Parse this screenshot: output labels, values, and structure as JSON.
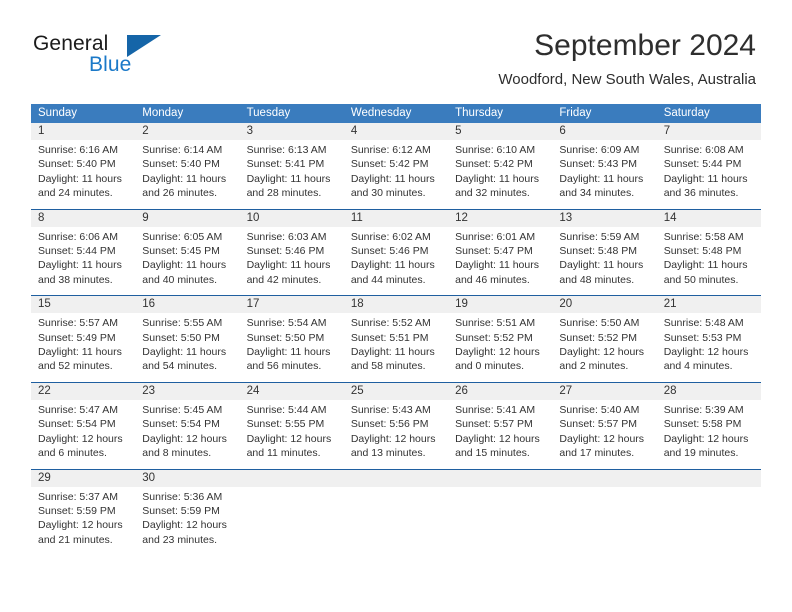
{
  "brand": {
    "name_part1": "General",
    "name_part2": "Blue",
    "logo_icon": "triangle-flag-icon"
  },
  "header": {
    "title": "September 2024",
    "location": "Woodford, New South Wales, Australia"
  },
  "weekdays": [
    "Sunday",
    "Monday",
    "Tuesday",
    "Wednesday",
    "Thursday",
    "Friday",
    "Saturday"
  ],
  "colors": {
    "header_band": "#3a7cbe",
    "row_divider": "#1f5fa0",
    "day_band": "#f0f0f0",
    "brand_blue": "#1b79c8",
    "text": "#333333"
  },
  "weeks": [
    [
      {
        "day": "1",
        "sunrise": "Sunrise: 6:16 AM",
        "sunset": "Sunset: 5:40 PM",
        "daylight": "Daylight: 11 hours and 24 minutes."
      },
      {
        "day": "2",
        "sunrise": "Sunrise: 6:14 AM",
        "sunset": "Sunset: 5:40 PM",
        "daylight": "Daylight: 11 hours and 26 minutes."
      },
      {
        "day": "3",
        "sunrise": "Sunrise: 6:13 AM",
        "sunset": "Sunset: 5:41 PM",
        "daylight": "Daylight: 11 hours and 28 minutes."
      },
      {
        "day": "4",
        "sunrise": "Sunrise: 6:12 AM",
        "sunset": "Sunset: 5:42 PM",
        "daylight": "Daylight: 11 hours and 30 minutes."
      },
      {
        "day": "5",
        "sunrise": "Sunrise: 6:10 AM",
        "sunset": "Sunset: 5:42 PM",
        "daylight": "Daylight: 11 hours and 32 minutes."
      },
      {
        "day": "6",
        "sunrise": "Sunrise: 6:09 AM",
        "sunset": "Sunset: 5:43 PM",
        "daylight": "Daylight: 11 hours and 34 minutes."
      },
      {
        "day": "7",
        "sunrise": "Sunrise: 6:08 AM",
        "sunset": "Sunset: 5:44 PM",
        "daylight": "Daylight: 11 hours and 36 minutes."
      }
    ],
    [
      {
        "day": "8",
        "sunrise": "Sunrise: 6:06 AM",
        "sunset": "Sunset: 5:44 PM",
        "daylight": "Daylight: 11 hours and 38 minutes."
      },
      {
        "day": "9",
        "sunrise": "Sunrise: 6:05 AM",
        "sunset": "Sunset: 5:45 PM",
        "daylight": "Daylight: 11 hours and 40 minutes."
      },
      {
        "day": "10",
        "sunrise": "Sunrise: 6:03 AM",
        "sunset": "Sunset: 5:46 PM",
        "daylight": "Daylight: 11 hours and 42 minutes."
      },
      {
        "day": "11",
        "sunrise": "Sunrise: 6:02 AM",
        "sunset": "Sunset: 5:46 PM",
        "daylight": "Daylight: 11 hours and 44 minutes."
      },
      {
        "day": "12",
        "sunrise": "Sunrise: 6:01 AM",
        "sunset": "Sunset: 5:47 PM",
        "daylight": "Daylight: 11 hours and 46 minutes."
      },
      {
        "day": "13",
        "sunrise": "Sunrise: 5:59 AM",
        "sunset": "Sunset: 5:48 PM",
        "daylight": "Daylight: 11 hours and 48 minutes."
      },
      {
        "day": "14",
        "sunrise": "Sunrise: 5:58 AM",
        "sunset": "Sunset: 5:48 PM",
        "daylight": "Daylight: 11 hours and 50 minutes."
      }
    ],
    [
      {
        "day": "15",
        "sunrise": "Sunrise: 5:57 AM",
        "sunset": "Sunset: 5:49 PM",
        "daylight": "Daylight: 11 hours and 52 minutes."
      },
      {
        "day": "16",
        "sunrise": "Sunrise: 5:55 AM",
        "sunset": "Sunset: 5:50 PM",
        "daylight": "Daylight: 11 hours and 54 minutes."
      },
      {
        "day": "17",
        "sunrise": "Sunrise: 5:54 AM",
        "sunset": "Sunset: 5:50 PM",
        "daylight": "Daylight: 11 hours and 56 minutes."
      },
      {
        "day": "18",
        "sunrise": "Sunrise: 5:52 AM",
        "sunset": "Sunset: 5:51 PM",
        "daylight": "Daylight: 11 hours and 58 minutes."
      },
      {
        "day": "19",
        "sunrise": "Sunrise: 5:51 AM",
        "sunset": "Sunset: 5:52 PM",
        "daylight": "Daylight: 12 hours and 0 minutes."
      },
      {
        "day": "20",
        "sunrise": "Sunrise: 5:50 AM",
        "sunset": "Sunset: 5:52 PM",
        "daylight": "Daylight: 12 hours and 2 minutes."
      },
      {
        "day": "21",
        "sunrise": "Sunrise: 5:48 AM",
        "sunset": "Sunset: 5:53 PM",
        "daylight": "Daylight: 12 hours and 4 minutes."
      }
    ],
    [
      {
        "day": "22",
        "sunrise": "Sunrise: 5:47 AM",
        "sunset": "Sunset: 5:54 PM",
        "daylight": "Daylight: 12 hours and 6 minutes."
      },
      {
        "day": "23",
        "sunrise": "Sunrise: 5:45 AM",
        "sunset": "Sunset: 5:54 PM",
        "daylight": "Daylight: 12 hours and 8 minutes."
      },
      {
        "day": "24",
        "sunrise": "Sunrise: 5:44 AM",
        "sunset": "Sunset: 5:55 PM",
        "daylight": "Daylight: 12 hours and 11 minutes."
      },
      {
        "day": "25",
        "sunrise": "Sunrise: 5:43 AM",
        "sunset": "Sunset: 5:56 PM",
        "daylight": "Daylight: 12 hours and 13 minutes."
      },
      {
        "day": "26",
        "sunrise": "Sunrise: 5:41 AM",
        "sunset": "Sunset: 5:57 PM",
        "daylight": "Daylight: 12 hours and 15 minutes."
      },
      {
        "day": "27",
        "sunrise": "Sunrise: 5:40 AM",
        "sunset": "Sunset: 5:57 PM",
        "daylight": "Daylight: 12 hours and 17 minutes."
      },
      {
        "day": "28",
        "sunrise": "Sunrise: 5:39 AM",
        "sunset": "Sunset: 5:58 PM",
        "daylight": "Daylight: 12 hours and 19 minutes."
      }
    ],
    [
      {
        "day": "29",
        "sunrise": "Sunrise: 5:37 AM",
        "sunset": "Sunset: 5:59 PM",
        "daylight": "Daylight: 12 hours and 21 minutes."
      },
      {
        "day": "30",
        "sunrise": "Sunrise: 5:36 AM",
        "sunset": "Sunset: 5:59 PM",
        "daylight": "Daylight: 12 hours and 23 minutes."
      },
      {
        "day": "",
        "sunrise": "",
        "sunset": "",
        "daylight": ""
      },
      {
        "day": "",
        "sunrise": "",
        "sunset": "",
        "daylight": ""
      },
      {
        "day": "",
        "sunrise": "",
        "sunset": "",
        "daylight": ""
      },
      {
        "day": "",
        "sunrise": "",
        "sunset": "",
        "daylight": ""
      },
      {
        "day": "",
        "sunrise": "",
        "sunset": "",
        "daylight": ""
      }
    ]
  ]
}
